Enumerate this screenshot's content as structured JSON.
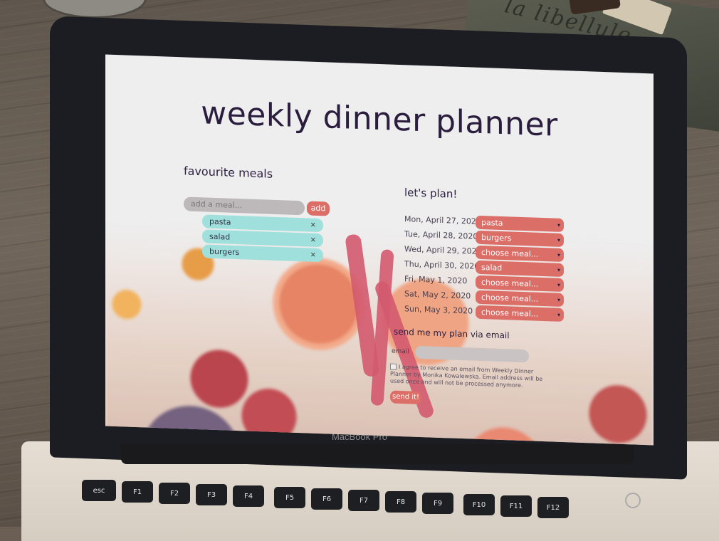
{
  "page": {
    "title": "weekly dinner planner"
  },
  "favourites": {
    "heading": "favourite meals",
    "input_placeholder": "add a meal...",
    "add_label": "add",
    "remove_symbol": "×",
    "items": [
      {
        "label": "pasta"
      },
      {
        "label": "salad"
      },
      {
        "label": "burgers"
      }
    ]
  },
  "plan": {
    "heading": "let's plan!",
    "arrow_symbol": "▾",
    "days": [
      {
        "date": "Mon, April 27, 2020",
        "meal": "pasta"
      },
      {
        "date": "Tue, April 28, 2020",
        "meal": "burgers"
      },
      {
        "date": "Wed, April 29, 2020",
        "meal": "choose meal..."
      },
      {
        "date": "Thu, April 30, 2020",
        "meal": "salad"
      },
      {
        "date": "Fri, May 1, 2020",
        "meal": "choose meal..."
      },
      {
        "date": "Sat, May 2, 2020",
        "meal": "choose meal..."
      },
      {
        "date": "Sun, May 3, 2020",
        "meal": "choose meal..."
      }
    ]
  },
  "email": {
    "heading": "send me my plan via email",
    "label": "email",
    "consent_text": "I agree to receive an email from Weekly Dinner Planner by Monika Kowalewska. Email address will be used once and will not be processed anymore.",
    "send_label": "send it!"
  },
  "device": {
    "brand": "MacBook Pro",
    "bag_text": "la libellule"
  },
  "keyboard": {
    "keys": [
      "esc",
      "F1",
      "F2",
      "F3",
      "F4",
      "F5",
      "F6",
      "F7",
      "F8",
      "F9",
      "F10",
      "F11",
      "F12"
    ]
  },
  "colors": {
    "accent": "#dc6e68",
    "favourite_bg": "#9fe0dc",
    "title": "#2a1d3e"
  }
}
